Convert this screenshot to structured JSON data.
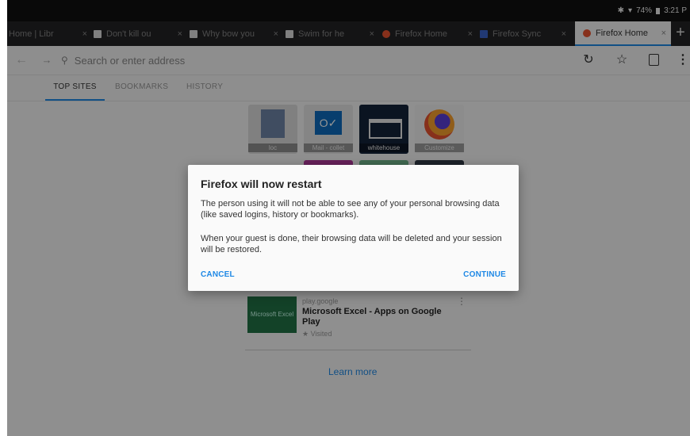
{
  "status_bar": {
    "battery": "74%",
    "time": "3:21 P"
  },
  "tabs": [
    {
      "title": "Home | Libr",
      "favicon": "library-icon"
    },
    {
      "title": "Don't kill ou",
      "favicon": "page-icon"
    },
    {
      "title": "Why bow you",
      "favicon": "page-icon"
    },
    {
      "title": "Swim for he",
      "favicon": "page-icon"
    },
    {
      "title": "Firefox Home",
      "favicon": "firefox-icon"
    },
    {
      "title": "Firefox Sync",
      "favicon": "sync-icon"
    },
    {
      "title": "Firefox Home",
      "favicon": "firefox-icon",
      "active": true
    }
  ],
  "toolbar": {
    "url_placeholder": "Search or enter address"
  },
  "panel_tabs": [
    "TOP SITES",
    "BOOKMARKS",
    "HISTORY"
  ],
  "top_sites": [
    {
      "label": "loc"
    },
    {
      "label": "Mail - collet"
    },
    {
      "label": "whitehouse"
    },
    {
      "label": "Customize"
    }
  ],
  "pocket": {
    "thumb_text": "Microsoft Excel",
    "source": "play.google",
    "title": "Microsoft Excel - Apps on Google Play",
    "visited": "Visited"
  },
  "learn_more": "Learn more",
  "dialog": {
    "title": "Firefox will now restart",
    "paragraph1": "The person using it will not be able to see any of your personal browsing data (like saved logins, history or bookmarks).",
    "paragraph2": "When your guest is done, their browsing data will be deleted and your session will be restored.",
    "cancel_label": "CANCEL",
    "continue_label": "CONTINUE"
  },
  "colors": {
    "accent": "#1e88e5",
    "tabstrip": "#232325",
    "statusbar": "#101010"
  }
}
